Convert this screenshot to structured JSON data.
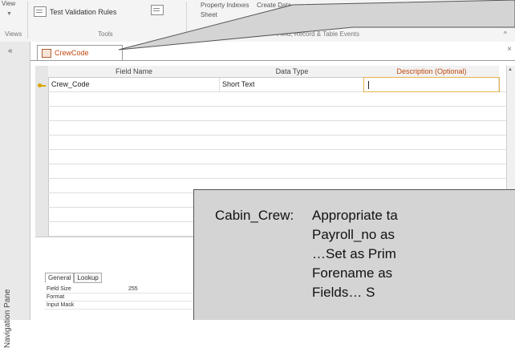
{
  "ribbon": {
    "view_label": "View",
    "test_validation_label": "Test Validation Rules",
    "property_sheet_label": "Property Indexes",
    "sheet_label": "Sheet",
    "create_label": "Create Data",
    "views_group": "Views",
    "tools_group": "Tools",
    "events_group": "Field, Record & Table Events"
  },
  "nav": {
    "pane_label": "Navigation Pane",
    "toggle": "«"
  },
  "tab": {
    "title": "CrewCode"
  },
  "grid": {
    "headers": [
      "Field Name",
      "Data Type",
      "Description (Optional)"
    ],
    "rows": [
      {
        "field_name": "Crew_Code",
        "data_type": "Short Text",
        "description": ""
      }
    ]
  },
  "props": {
    "tabs": [
      "General",
      "Lookup"
    ],
    "rows": [
      {
        "name": "Field Size",
        "value": "255"
      },
      {
        "name": "Format",
        "value": ""
      },
      {
        "name": "Input Mask",
        "value": ""
      }
    ]
  },
  "callout": {
    "label": "Cabin_Crew:",
    "lines": [
      "Appropriate ta",
      "Payroll_no as",
      "…Set as Prim",
      "Forename as",
      "Fields…  S"
    ]
  },
  "colors": {
    "accent": "#c1480d",
    "active_outline": "#e7b24b",
    "callout_bg": "#d4d4d4"
  }
}
